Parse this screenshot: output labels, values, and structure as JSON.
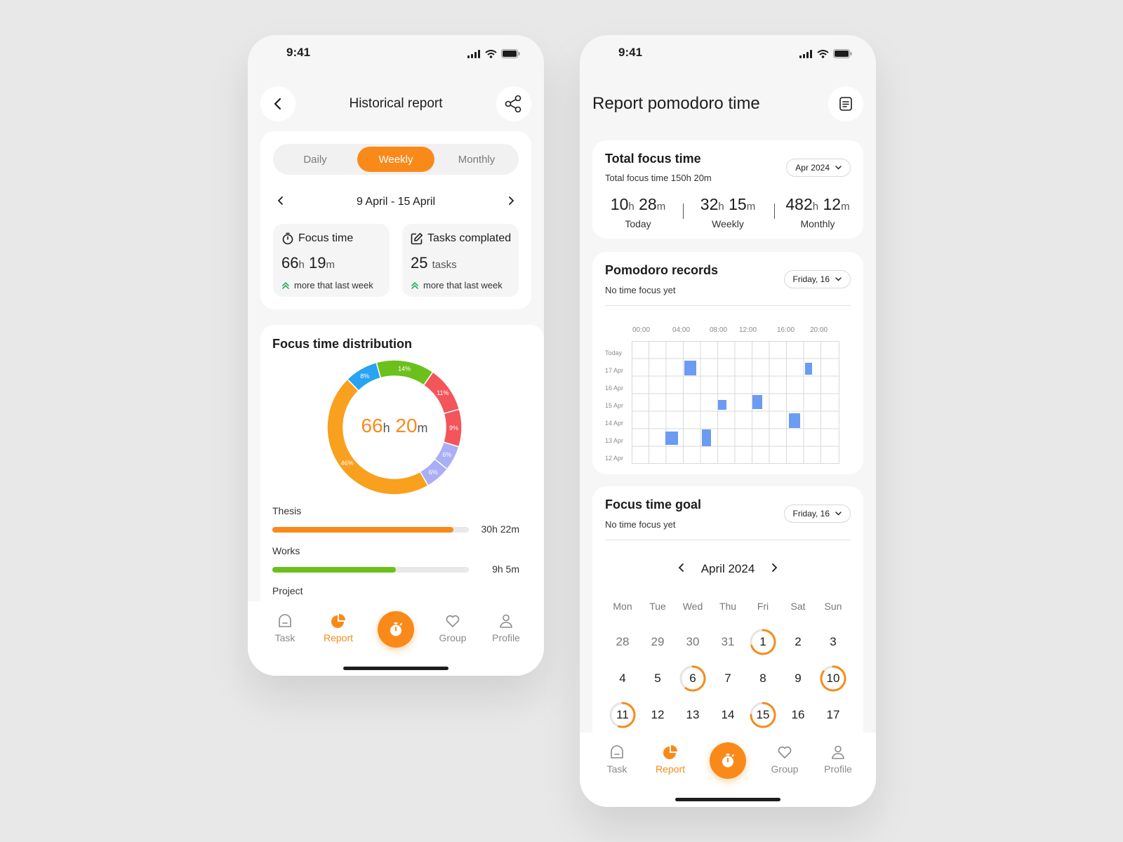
{
  "status": {
    "time": "9:41"
  },
  "left": {
    "title": "Historical report",
    "tabs": [
      "Daily",
      "Weekly",
      "Monthly"
    ],
    "range": "9 April - 15 April",
    "focus": {
      "label": "Focus time",
      "hours": "66",
      "h": "h",
      "minutes": "19",
      "m": "m",
      "note": "more that last week"
    },
    "tasks": {
      "label": "Tasks complated",
      "count": "25",
      "unit": "tasks",
      "note": "more that last week"
    },
    "distribution": {
      "title": "Focus time distribution",
      "center_hours": "66",
      "center_h": "h",
      "center_minutes": "20",
      "center_m": "m"
    },
    "bars": [
      {
        "label": "Thesis",
        "value": "30h 22m",
        "fill": 0.92,
        "color": "#f98a1a"
      },
      {
        "label": "Works",
        "value": "9h 5m",
        "fill": 0.63,
        "color": "#6cc01c"
      },
      {
        "label": "Project"
      }
    ]
  },
  "chart_data": {
    "type": "pie",
    "labels": [
      "46%",
      "8%",
      "14%",
      "11%",
      "9%",
      "6%",
      "6%"
    ],
    "values": [
      46,
      8,
      14,
      11,
      9,
      6,
      6
    ],
    "colors": [
      "#f9a01e",
      "#28a4f2",
      "#6cc01c",
      "#f2555a",
      "#f2555a",
      "#a9aef5",
      "#a9aef5"
    ]
  },
  "nav": {
    "task": "Task",
    "report": "Report",
    "group": "Group",
    "profile": "Profile"
  },
  "right": {
    "title": "Report pomodoro time",
    "total": {
      "title": "Total focus time",
      "sub": "Total focus time 150h 20m",
      "month_pill": "Apr 2024",
      "today": {
        "h": "10",
        "m": "28",
        "label": "Today"
      },
      "weekly": {
        "h": "32",
        "m": "15",
        "label": "Weekly"
      },
      "monthly": {
        "h": "482",
        "m": "12",
        "label": "Monthly"
      },
      "hu": "h",
      "mu": "m"
    },
    "records": {
      "title": "Pomodoro records",
      "sub": "No time focus yet",
      "pill": "Friday, 16",
      "hours": [
        "00:00",
        "04:00",
        "08:00",
        "12:00",
        "16:00",
        "20:00"
      ],
      "days": [
        "Today",
        "17 Apr",
        "16 Apr",
        "15 Apr",
        "14 Apr",
        "13 Apr",
        "12 Apr"
      ]
    },
    "goal": {
      "title": "Focus time goal",
      "sub": "No time focus yet",
      "pill": "Friday, 16",
      "month": "April 2024",
      "weekdays": [
        "Mon",
        "Tue",
        "Wed",
        "Thu",
        "Fri",
        "Sat",
        "Sun"
      ],
      "rows": [
        [
          "28",
          "29",
          "30",
          "31",
          "1",
          "2",
          "3"
        ],
        [
          "4",
          "5",
          "6",
          "7",
          "8",
          "9",
          "10"
        ],
        [
          "11",
          "12",
          "13",
          "14",
          "15",
          "16",
          "17"
        ]
      ]
    }
  }
}
